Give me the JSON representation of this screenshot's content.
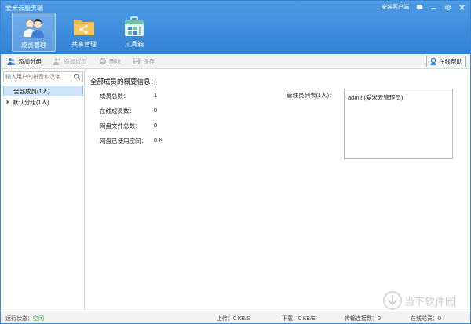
{
  "app": {
    "title": "爱米云服务端"
  },
  "topbar": {
    "install_client": "安装客户端"
  },
  "nav": [
    {
      "label": "成员管理",
      "icon": "members-icon",
      "active": true
    },
    {
      "label": "共享管理",
      "icon": "share-folder-icon",
      "active": false
    },
    {
      "label": "工具箱",
      "icon": "toolbox-icon",
      "active": false
    }
  ],
  "toolbar": {
    "add_group": "添加分组",
    "add_member": "添加成员",
    "delete": "删除",
    "save": "保存",
    "online_help": "在线帮助"
  },
  "sidebar": {
    "search_placeholder": "输入用户的拼音和汉字",
    "tree": [
      {
        "label": "全部成员(1人)",
        "selected": true
      },
      {
        "label": "默认分组(1人)",
        "selected": false
      }
    ]
  },
  "main": {
    "section_title": "全部成员的概要信息：",
    "stats": [
      {
        "label": "成员总数：",
        "value": "1"
      },
      {
        "label": "在线成员数：",
        "value": "0"
      },
      {
        "label": "网盘文件总数：",
        "value": "0"
      },
      {
        "label": "网盘已使用空间：",
        "value": "0 K"
      }
    ],
    "admin_label": "管理员列表(1人)：",
    "admins": [
      "admin(爱米云管理员)"
    ]
  },
  "status": {
    "run_label": "运行状态：",
    "run_value": "空闲",
    "upload_label": "上传：",
    "upload_value": "0 KB/S",
    "download_label": "下载：",
    "download_value": "0 KB/S",
    "conn_label": "传输连接数：",
    "conn_value": "0",
    "online_label": "在线成员：",
    "online_value": "0"
  },
  "watermark": {
    "text": "当下软件园"
  },
  "colors": {
    "header": "#3b8ad9",
    "selected": "#cfe3f8",
    "status_ok": "#2a9d2a"
  }
}
